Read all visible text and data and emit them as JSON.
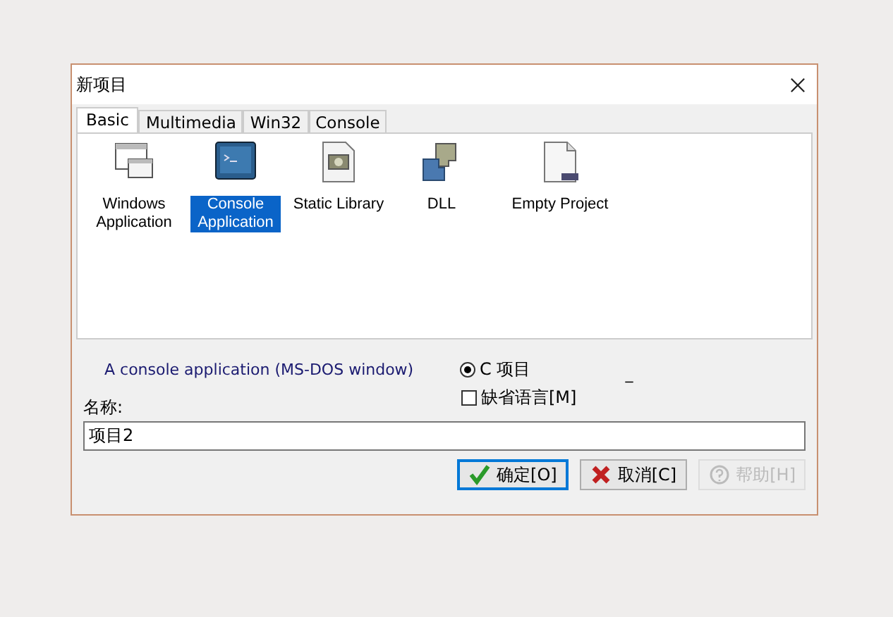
{
  "window": {
    "title": "新项目"
  },
  "tabs": [
    {
      "label": "Basic",
      "selected": true
    },
    {
      "label": "Multimedia",
      "selected": false
    },
    {
      "label": "Win32",
      "selected": false
    },
    {
      "label": "Console",
      "selected": false
    }
  ],
  "templates": [
    {
      "kind": "window",
      "label": "Windows Application",
      "selected": false
    },
    {
      "kind": "console",
      "label": "Console Application",
      "selected": true
    },
    {
      "kind": "library",
      "label": "Static Library",
      "selected": false
    },
    {
      "kind": "puzzle",
      "label": "DLL",
      "selected": false
    },
    {
      "kind": "document",
      "label": "Empty Project",
      "selected": false
    }
  ],
  "description": "A console application (MS-DOS window)",
  "language_option": {
    "label": "C 项目",
    "selected": true
  },
  "extra_mark": "_",
  "default_language": {
    "label": "缺省语言[M]",
    "checked": false
  },
  "name_label": "名称:",
  "name_field": {
    "value": "项目2"
  },
  "buttons": [
    {
      "kind": "ok",
      "label": "确定[O]",
      "disabled": false
    },
    {
      "kind": "cancel",
      "label": "取消[C]",
      "disabled": false
    },
    {
      "kind": "help",
      "label": "帮助[H]",
      "disabled": true
    }
  ]
}
